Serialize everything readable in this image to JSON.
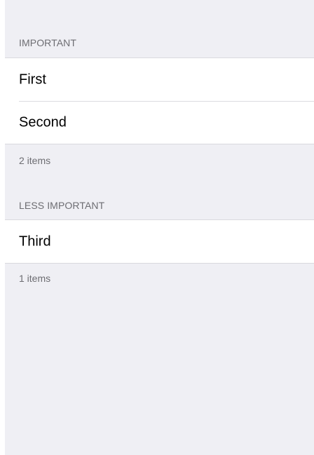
{
  "sections": [
    {
      "header": "IMPORTANT",
      "items": [
        {
          "label": "First"
        },
        {
          "label": "Second"
        }
      ],
      "footer": "2 items"
    },
    {
      "header": "LESS IMPORTANT",
      "items": [
        {
          "label": "Third"
        }
      ],
      "footer": "1 items"
    }
  ],
  "colors": {
    "background": "#efeff4",
    "cell_background": "#ffffff",
    "separator": "#dcdce0",
    "header_text": "#6d6d72"
  }
}
